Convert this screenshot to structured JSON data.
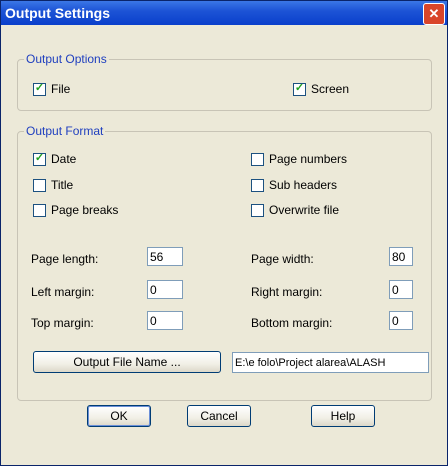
{
  "window": {
    "title": "Output Settings",
    "close_label": "✕"
  },
  "output_options": {
    "legend": "Output Options",
    "file": {
      "label": "File",
      "checked": true
    },
    "screen": {
      "label": "Screen",
      "checked": true
    }
  },
  "output_format": {
    "legend": "Output Format",
    "date": {
      "label": "Date",
      "checked": true
    },
    "page_numbers": {
      "label": "Page numbers",
      "checked": false
    },
    "title": {
      "label": "Title",
      "checked": false
    },
    "sub_headers": {
      "label": "Sub headers",
      "checked": false
    },
    "page_breaks": {
      "label": "Page breaks",
      "checked": false
    },
    "overwrite_file": {
      "label": "Overwrite file",
      "checked": false
    },
    "page_length": {
      "label": "Page length:",
      "value": "56"
    },
    "page_width": {
      "label": "Page width:",
      "value": "80"
    },
    "left_margin": {
      "label": "Left margin:",
      "value": "0"
    },
    "right_margin": {
      "label": "Right margin:",
      "value": "0"
    },
    "top_margin": {
      "label": "Top margin:",
      "value": "0"
    },
    "bottom_margin": {
      "label": "Bottom margin:",
      "value": "0"
    },
    "output_file_button": "Output File Name ...",
    "output_file_path": "E:\\e folo\\Project alarea\\ALASH"
  },
  "buttons": {
    "ok": "OK",
    "cancel": "Cancel",
    "help": "Help"
  },
  "colors": {
    "check_mark": "#21a121",
    "legend_text": "#1f3fbf"
  }
}
